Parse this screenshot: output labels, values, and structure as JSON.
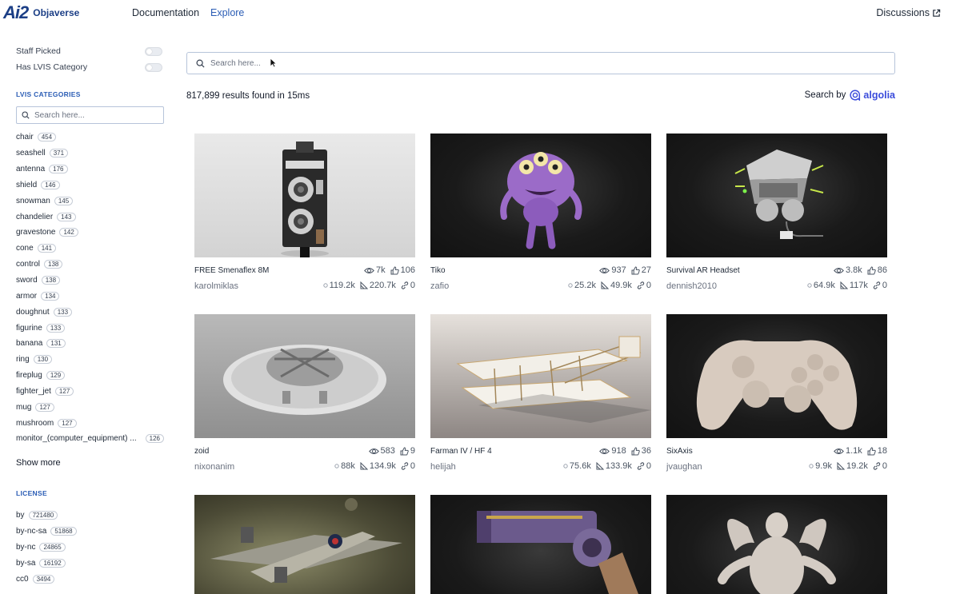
{
  "header": {
    "logo_mark": "Ai2",
    "logo_text": "Objaverse",
    "nav": [
      "Documentation",
      "Explore"
    ],
    "discussions": "Discussions"
  },
  "sidebar": {
    "filters": [
      {
        "label": "Staff Picked",
        "enabled": false
      },
      {
        "label": "Has LVIS Category",
        "enabled": false
      }
    ],
    "lvis_title": "LVIS CATEGORIES",
    "search_placeholder": "Search here...",
    "categories": [
      {
        "label": "chair",
        "count": "454"
      },
      {
        "label": "seashell",
        "count": "371"
      },
      {
        "label": "antenna",
        "count": "176"
      },
      {
        "label": "shield",
        "count": "146"
      },
      {
        "label": "snowman",
        "count": "145"
      },
      {
        "label": "chandelier",
        "count": "143"
      },
      {
        "label": "gravestone",
        "count": "142"
      },
      {
        "label": "cone",
        "count": "141"
      },
      {
        "label": "control",
        "count": "138"
      },
      {
        "label": "sword",
        "count": "138"
      },
      {
        "label": "armor",
        "count": "134"
      },
      {
        "label": "doughnut",
        "count": "133"
      },
      {
        "label": "figurine",
        "count": "133"
      },
      {
        "label": "banana",
        "count": "131"
      },
      {
        "label": "ring",
        "count": "130"
      },
      {
        "label": "fireplug",
        "count": "129"
      },
      {
        "label": "fighter_jet",
        "count": "127"
      },
      {
        "label": "mug",
        "count": "127"
      },
      {
        "label": "mushroom",
        "count": "127"
      },
      {
        "label": "monitor_(computer_equipment) ...",
        "count": "126"
      }
    ],
    "show_more": "Show more",
    "license_title": "LICENSE",
    "licenses": [
      {
        "label": "by",
        "count": "721480"
      },
      {
        "label": "by-nc-sa",
        "count": "51868"
      },
      {
        "label": "by-nc",
        "count": "24865"
      },
      {
        "label": "by-sa",
        "count": "16192"
      },
      {
        "label": "cc0",
        "count": "3494"
      }
    ]
  },
  "main": {
    "search_placeholder": "Search here...",
    "results_text": "817,899 results found in 15ms",
    "search_by": "Search by",
    "algolia": "algolia",
    "cards": [
      {
        "title": "FREE Smenaflex 8M",
        "author": "karolmiklas",
        "views": "7k",
        "likes": "106",
        "vertices": "119.2k",
        "faces": "220.7k",
        "animations": "0",
        "theme": "light",
        "art": "camera"
      },
      {
        "title": "Tiko",
        "author": "zafio",
        "views": "937",
        "likes": "27",
        "vertices": "25.2k",
        "faces": "49.9k",
        "animations": "0",
        "theme": "dark",
        "art": "monster"
      },
      {
        "title": "Survival AR Headset",
        "author": "dennish2010",
        "views": "3.8k",
        "likes": "86",
        "vertices": "64.9k",
        "faces": "117k",
        "animations": "0",
        "theme": "dark",
        "art": "headset"
      },
      {
        "title": "zoid",
        "author": "nixonanim",
        "views": "583",
        "likes": "9",
        "vertices": "88k",
        "faces": "134.9k",
        "animations": "0",
        "theme": "mid",
        "art": "ufo"
      },
      {
        "title": "Farman IV / HF 4",
        "author": "helijah",
        "views": "918",
        "likes": "36",
        "vertices": "75.6k",
        "faces": "133.9k",
        "animations": "0",
        "theme": "warm",
        "art": "biplane"
      },
      {
        "title": "SixAxis",
        "author": "jvaughan",
        "views": "1.1k",
        "likes": "18",
        "vertices": "9.9k",
        "faces": "19.2k",
        "animations": "0",
        "theme": "dark",
        "art": "controller"
      },
      {
        "title": "",
        "author": "",
        "views": "",
        "likes": "",
        "vertices": "",
        "faces": "",
        "animations": "",
        "theme": "green",
        "art": "plane"
      },
      {
        "title": "",
        "author": "",
        "views": "",
        "likes": "",
        "vertices": "",
        "faces": "",
        "animations": "",
        "theme": "dark",
        "art": "gun"
      },
      {
        "title": "",
        "author": "",
        "views": "",
        "likes": "",
        "vertices": "",
        "faces": "",
        "animations": "",
        "theme": "dark",
        "art": "creature"
      }
    ]
  },
  "colors": {
    "brand": "#1c3f86",
    "link_active": "#2b5db5",
    "algolia": "#3b4cdb"
  }
}
